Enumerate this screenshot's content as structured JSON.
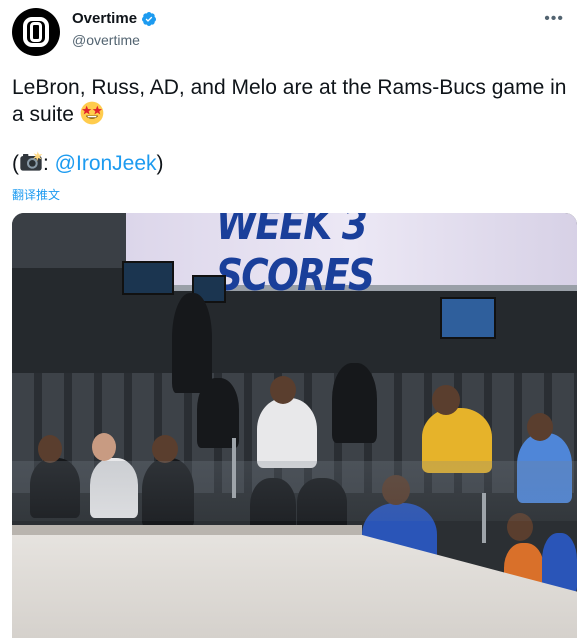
{
  "tweet": {
    "display_name": "Overtime",
    "handle": "@overtime",
    "more_icon": "more-horizontal-icon",
    "verified": true,
    "text_line1": "LeBron, Russ, AD, and Melo are at the Rams-Bucs game in a suite",
    "emoji_1": "star-struck-emoji",
    "credit_open": "(",
    "camera_emoji": "camera-flash-emoji",
    "credit_colon": ": ",
    "credit_mention": "@IronJeek",
    "credit_close": ")",
    "translate_label": "翻译推文",
    "accent_color": "#1d9bf0"
  },
  "photo": {
    "scoreboard_text": "WEEK 3 SCORES"
  }
}
